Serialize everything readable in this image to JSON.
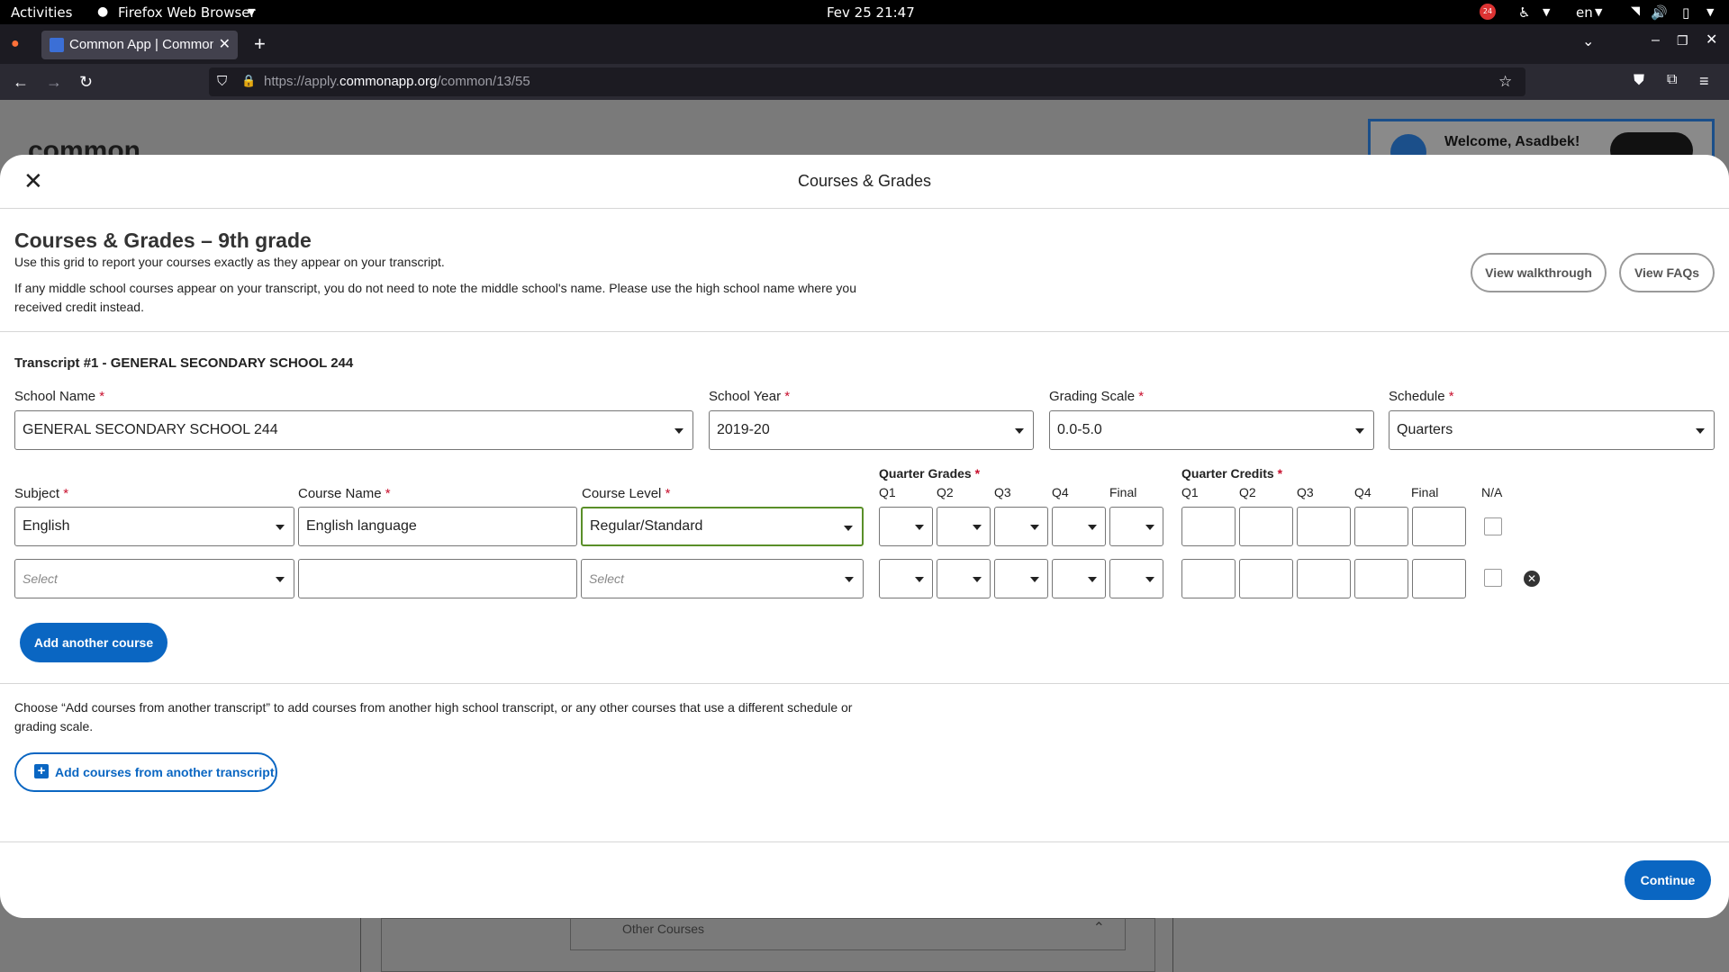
{
  "system_bar": {
    "activities": "Activities",
    "app_name": "Firefox Web Browser",
    "clock": "Fev 25  21:47",
    "notification_count": "24",
    "language": "en"
  },
  "browser": {
    "tab_title": "Common App | Common",
    "url_prefix": "https://apply.",
    "url_domain": "commonapp.org",
    "url_path": "/common/13/55"
  },
  "background_page": {
    "logo_text": "common",
    "welcome": "Welcome, Asadbek!",
    "other_courses": "Other Courses"
  },
  "modal": {
    "title": "Courses & Grades",
    "heading": "Courses & Grades – 9th grade",
    "intro_line1": "Use this grid to report your courses exactly as they appear on your transcript.",
    "intro_line2a": "If any middle school courses appear on your transcript, you do not need to note the middle school's name. Please use the high school name where you",
    "intro_line2b": "received credit instead.",
    "view_walkthrough": "View walkthrough",
    "view_faqs": "View FAQs",
    "transcript_title": "Transcript #1 - GENERAL SECONDARY SCHOOL 244",
    "fields": {
      "school_name_label": "School Name",
      "school_name_value": "GENERAL SECONDARY SCHOOL 244",
      "school_year_label": "School Year",
      "school_year_value": "2019-20",
      "grading_scale_label": "Grading Scale",
      "grading_scale_value": "0.0-5.0",
      "schedule_label": "Schedule",
      "schedule_value": "Quarters"
    },
    "grid": {
      "subject_label": "Subject",
      "course_name_label": "Course Name",
      "course_level_label": "Course Level",
      "quarter_grades_label": "Quarter Grades",
      "quarter_credits_label": "Quarter Credits",
      "na_label": "N/A",
      "period_cols": [
        "Q1",
        "Q2",
        "Q3",
        "Q4",
        "Final"
      ],
      "rows": [
        {
          "subject": "English",
          "course_name": "English language",
          "course_level": "Regular/Standard"
        },
        {
          "subject": "Select",
          "course_name": "",
          "course_level": "Select"
        }
      ]
    },
    "add_course": "Add another course",
    "other_transcript_line1": "Choose “Add courses from another transcript” to add courses from another high school transcript, or any other courses that use a different schedule or",
    "other_transcript_line2": "grading scale.",
    "add_transcript": "Add courses from another transcript",
    "continue": "Continue"
  },
  "colors": {
    "primary": "#0a66c2",
    "required": "#c8102e",
    "focus": "#5a8f29"
  }
}
